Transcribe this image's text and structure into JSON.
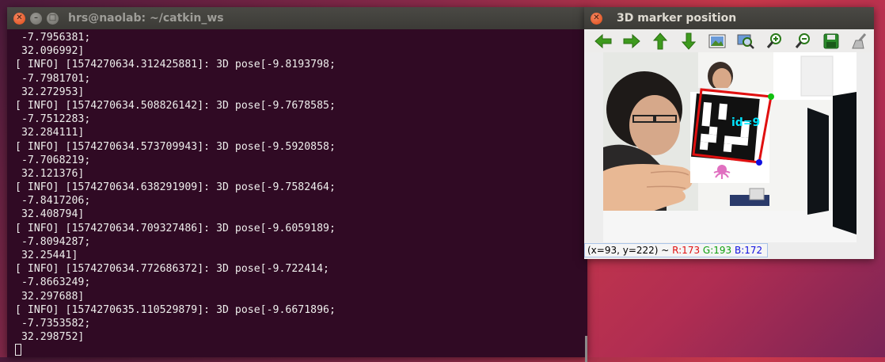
{
  "terminal": {
    "title": "hrs@naolab: ~/catkin_ws",
    "lines": [
      " -7.7956381;",
      " 32.096992]",
      "[ INFO] [1574270634.312425881]: 3D pose[-9.8193798;",
      " -7.7981701;",
      " 32.272953]",
      "[ INFO] [1574270634.508826142]: 3D pose[-9.7678585;",
      " -7.7512283;",
      " 32.284111]",
      "[ INFO] [1574270634.573709943]: 3D pose[-9.5920858;",
      " -7.7068219;",
      " 32.121376]",
      "[ INFO] [1574270634.638291909]: 3D pose[-9.7582464;",
      " -7.8417206;",
      " 32.408794]",
      "[ INFO] [1574270634.709327486]: 3D pose[-9.6059189;",
      " -7.8094287;",
      " 32.25441]",
      "[ INFO] [1574270634.772686372]: 3D pose[-9.722414;",
      " -7.8663249;",
      " 32.297688]",
      "[ INFO] [1574270635.110529879]: 3D pose[-9.6671896;",
      " -7.7353582;",
      " 32.298752]"
    ]
  },
  "viewer": {
    "title": "3D marker position",
    "toolbar": [
      "back-arrow-icon",
      "forward-arrow-icon",
      "up-arrow-icon",
      "down-arrow-icon",
      "image-icon",
      "zoom-fit-icon",
      "zoom-in-icon",
      "zoom-out-icon",
      "save-icon",
      "clear-icon"
    ],
    "marker_label": "id=9",
    "status": {
      "coords": "(x=93, y=222)",
      "sep": " ~ ",
      "r": "R:173",
      "g": "G:193",
      "b": "B:172"
    }
  },
  "colors": {
    "terminal_bg": "#300a24",
    "marker_box": "#e01010",
    "marker_label": "#00e5ff"
  }
}
